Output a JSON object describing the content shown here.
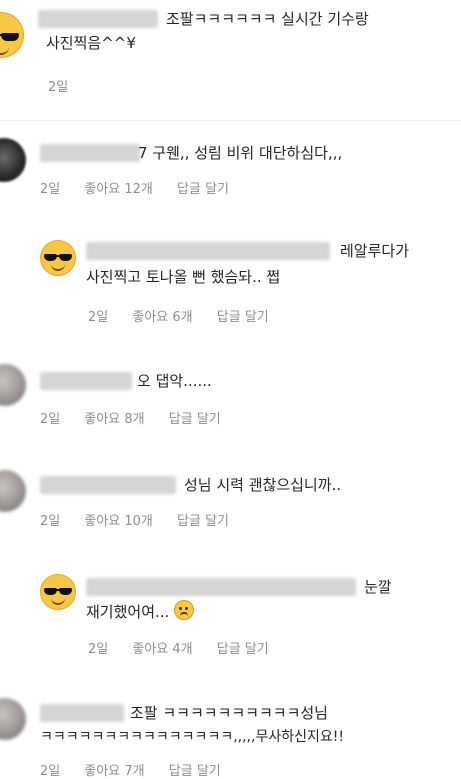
{
  "comments": [
    {
      "text1": "조팔ㅋㅋㅋㅋㅋㅋ 실시간 기수랑",
      "text2": "사진찍음^^¥",
      "time": "2일",
      "likes": "",
      "reply": ""
    },
    {
      "text1": "7 구웬,, 성림 비위 대단하심다,,,",
      "text2": "",
      "time": "2일",
      "likes": "좋아요 12개",
      "reply": "답글 달기"
    },
    {
      "text1": "레알루다가",
      "text2": "사진찍고 토나올 뻔 했슴돠.. 쩝",
      "time": "2일",
      "likes": "좋아요 6개",
      "reply": "답글 달기"
    },
    {
      "text1": "오 댑악......",
      "text2": "",
      "time": "2일",
      "likes": "좋아요 8개",
      "reply": "답글 달기"
    },
    {
      "text1": "성님 시력 괜찮으십니까..",
      "text2": "",
      "time": "2일",
      "likes": "좋아요 10개",
      "reply": "답글 달기"
    },
    {
      "text1": "눈깔",
      "text2": "재기했어여...",
      "time": "2일",
      "likes": "좋아요 4개",
      "reply": "답글 달기"
    },
    {
      "text1": "조팔 ㅋㅋㅋㅋㅋㅋㅋㅋㅋㅋ성님",
      "text2": "ㅋㅋㅋㅋㅋㅋㅋㅋㅋㅋㅋㅋㅋㅋㅋ,,,,,무사하신지요!!",
      "time": "2일",
      "likes": "좋아요 7개",
      "reply": "답글 달기"
    }
  ]
}
